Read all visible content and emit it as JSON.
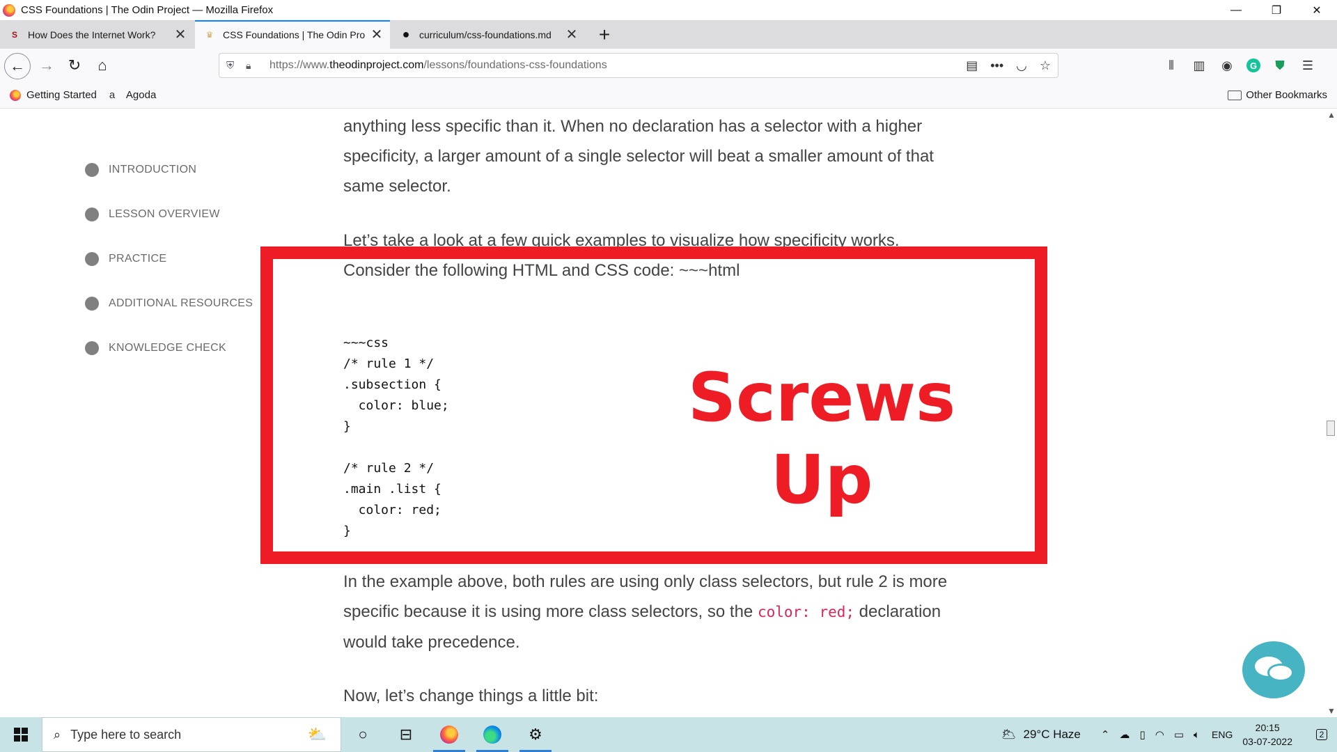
{
  "window": {
    "title": "CSS Foundations | The Odin Project — Mozilla Firefox",
    "minimize": "—",
    "maximize": "❐",
    "close": "✕"
  },
  "tabs": [
    {
      "label": "How Does the Internet Work?",
      "favicon": "S",
      "close": "✕"
    },
    {
      "label": "CSS Foundations | The Odin Pro",
      "favicon": "♛",
      "close": "✕"
    },
    {
      "label": "curriculum/css-foundations.md",
      "favicon": "●",
      "close": "✕"
    }
  ],
  "new_tab": "+",
  "nav": {
    "back": "←",
    "forward": "→",
    "reload": "↻",
    "home": "⌂",
    "url_prefix": "https://www.",
    "url_domain": "theodinproject.com",
    "url_path": "/lessons/foundations-css-foundations"
  },
  "bookmarks": {
    "items": [
      {
        "label": "Getting Started"
      },
      {
        "label": "Agoda"
      }
    ],
    "other": "Other Bookmarks"
  },
  "toc": [
    {
      "label": "INTRODUCTION"
    },
    {
      "label": "LESSON OVERVIEW"
    },
    {
      "label": "PRACTICE"
    },
    {
      "label": "ADDITIONAL RESOURCES"
    },
    {
      "label": "KNOWLEDGE CHECK"
    }
  ],
  "content": {
    "para1_l1": "anything less specific than it. When no declaration has a selector with a higher",
    "para1_l2": "specificity, a larger amount of a single selector will beat a smaller amount of that",
    "para1_l3": "same selector.",
    "para2_l1": "Let’s take a look at a few quick examples to visualize how specificity works.",
    "para2_l2": "Consider the following HTML and CSS code: ~~~html",
    "code": "~~~css\n/* rule 1 */\n.subsection {\n  color: blue;\n}\n\n/* rule 2 */\n.main .list {\n  color: red;\n}",
    "para3_l1": "In the example above, both rules are using only class selectors, but rule 2 is more",
    "para3_l2_a": "specific because it is using more class selectors, so the ",
    "para3_l2_code": "color: red;",
    "para3_l2_b": " declaration",
    "para3_l3": "would take precedence.",
    "para4": "Now, let’s change things a little bit:"
  },
  "annotation": {
    "line1": "Screws",
    "line2": "Up",
    "color": "#ee1c24"
  },
  "taskbar": {
    "search_placeholder": "Type here to search",
    "weather": "29°C  Haze",
    "lang": "ENG",
    "time": "20:15",
    "date": "03-07-2022",
    "notifications": "2"
  }
}
